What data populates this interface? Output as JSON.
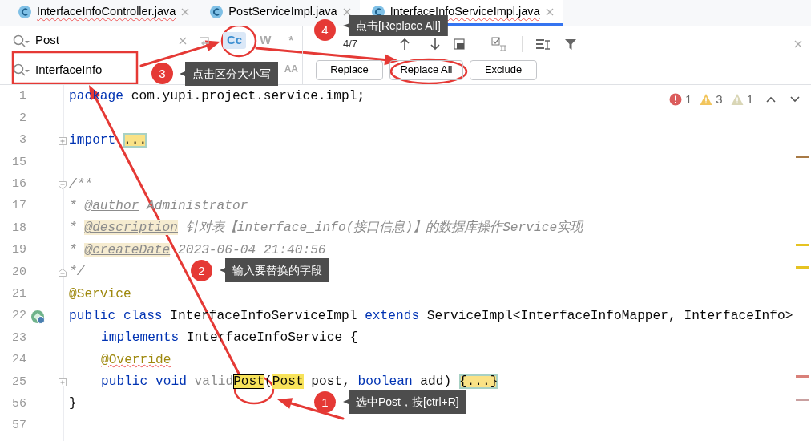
{
  "tabs": [
    {
      "label": "InterfaceInfoController.java",
      "selected": false,
      "has_error": true
    },
    {
      "label": "PostServiceImpl.java",
      "selected": false,
      "has_error": false
    },
    {
      "label": "InterfaceInfoServiceImpl.java",
      "selected": true,
      "has_error": true
    }
  ],
  "find": {
    "query": "Post",
    "replacement": "InterfaceInfo",
    "match_count": "4/7",
    "options": [
      {
        "label": "Cc",
        "on": true
      },
      {
        "label": "W",
        "on": false
      },
      {
        "label": "*",
        "on": false
      }
    ],
    "replace_options": [
      {
        "label": "AA",
        "on": false
      }
    ],
    "buttons": [
      "Replace",
      "Replace All",
      "Exclude"
    ]
  },
  "inspections": [
    {
      "kind": "error",
      "count": "1"
    },
    {
      "kind": "warning",
      "count": "3"
    },
    {
      "kind": "weak_warning",
      "count": "1"
    }
  ],
  "lines": [
    {
      "number": "1",
      "tokens": [
        {
          "text": "package",
          "kind": "kw"
        },
        {
          "text": " com.yupi.project.service.impl;",
          "kind": "plain"
        }
      ]
    },
    {
      "number": "2"
    },
    {
      "number": "3",
      "fold": {
        "kind": "expand"
      },
      "tokens": [
        {
          "text": "import ",
          "kind": "kw"
        },
        {
          "text": "...",
          "kind": "folded"
        }
      ]
    },
    {
      "number": "15"
    },
    {
      "number": "16",
      "fold": {
        "kind": "collapse"
      },
      "tokens": [
        {
          "text": "/**",
          "kind": "comment"
        }
      ]
    },
    {
      "number": "17",
      "tokens": [
        {
          "text": "* ",
          "kind": "comment"
        },
        {
          "text": "@author",
          "kind": "doctag"
        },
        {
          "text": " Administrator",
          "kind": "comment"
        }
      ]
    },
    {
      "number": "18",
      "tokens": [
        {
          "text": "* ",
          "kind": "comment"
        },
        {
          "text": "@description",
          "kind": "doctag_hl"
        },
        {
          "text": " 针对表【interface_info(接口信息)】的数据库操作Service实现",
          "kind": "comment"
        }
      ]
    },
    {
      "number": "19",
      "tokens": [
        {
          "text": "* ",
          "kind": "comment"
        },
        {
          "text": "@createDate",
          "kind": "doctag_hl"
        },
        {
          "text": " 2023-06-04 21:40:56",
          "kind": "comment"
        }
      ]
    },
    {
      "number": "20",
      "fold": {
        "kind": "end"
      },
      "tokens": [
        {
          "text": "*/",
          "kind": "comment"
        }
      ]
    },
    {
      "number": "21",
      "tokens": [
        {
          "text": "@Service",
          "kind": "anno"
        }
      ]
    },
    {
      "number": "22",
      "gutter_icon": {
        "kind": "implemented"
      },
      "tokens": [
        {
          "text": "public class",
          "kind": "kw"
        },
        {
          "text": " InterfaceInfoServiceImpl ",
          "kind": "plain"
        },
        {
          "text": "extends",
          "kind": "kw"
        },
        {
          "text": " ServiceImpl<InterfaceInfoMapper, InterfaceInfo>",
          "kind": "plain"
        }
      ]
    },
    {
      "number": "23",
      "indented": true,
      "tokens": [
        {
          "text": "implements",
          "kind": "kw"
        },
        {
          "text": " InterfaceInfoService {",
          "kind": "plain"
        }
      ]
    },
    {
      "number": "24",
      "indented": true,
      "tokens": [
        {
          "text": "@Override",
          "kind": "anno_err"
        }
      ]
    },
    {
      "number": "25",
      "indented": true,
      "fold": {
        "kind": "expand"
      },
      "tokens": [
        {
          "text": "public void ",
          "kind": "kw"
        },
        {
          "text": "valid",
          "kind": "unused"
        },
        {
          "text": "Post",
          "kind": "match_current"
        },
        {
          "text": "(",
          "kind": "plain"
        },
        {
          "text": "Post",
          "kind": "match"
        },
        {
          "text": " post, ",
          "kind": "plain"
        },
        {
          "text": "boolean",
          "kind": "kw"
        },
        {
          "text": " add) ",
          "kind": "plain"
        },
        {
          "text": "{...}",
          "kind": "folded"
        }
      ]
    },
    {
      "number": "56",
      "tokens": [
        {
          "text": "}",
          "kind": "plain"
        }
      ]
    },
    {
      "number": "57"
    }
  ],
  "annotations": [
    {
      "number": "4",
      "text": "点击[Replace All]"
    },
    {
      "number": "3",
      "text": "点击区分大小写"
    },
    {
      "number": "2",
      "text": "输入要替换的字段"
    },
    {
      "number": "1",
      "text": "选中Post，按[ctrl+R]"
    }
  ]
}
